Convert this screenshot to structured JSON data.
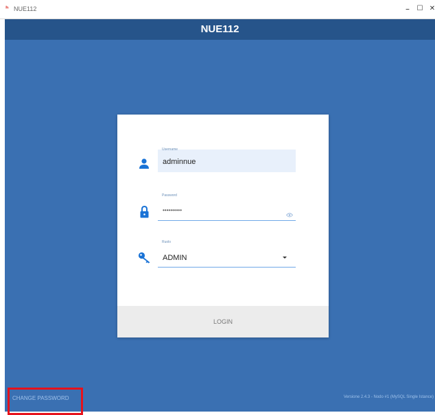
{
  "window": {
    "app_icon": "ʰ",
    "title": "NUE112",
    "minimize": "–",
    "maximize": "☐",
    "close": "✕"
  },
  "header": {
    "title": "NUE112"
  },
  "login": {
    "username": {
      "label": "Username",
      "value": "adminnue",
      "icon": "user-icon"
    },
    "password": {
      "label": "Password",
      "value": "••••••••••",
      "icon": "lock-icon",
      "toggle_icon": "eye-icon"
    },
    "role": {
      "label": "Ruolo",
      "value": "ADMIN",
      "icon": "key-icon",
      "dropdown_icon": "caret-down-icon"
    },
    "login_label": "LOGIN"
  },
  "footer": {
    "change_password": "CHANGE PASSWORD",
    "version": "Versione 2.4.3 - Nodo #1 (MySQL Single Istance)"
  },
  "colors": {
    "header": "#26548a",
    "background": "#3a70b2",
    "accent": "#1a73d6",
    "highlight": "#e6121c"
  }
}
